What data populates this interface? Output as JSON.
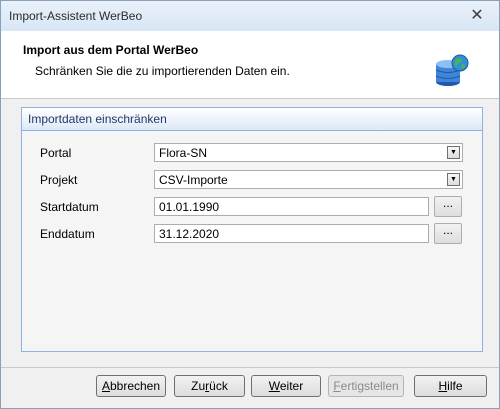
{
  "window": {
    "title": "Import-Assistent WerBeo",
    "close_label": "✕"
  },
  "header": {
    "title": "Import aus dem Portal WerBeo",
    "subtitle": "Schränken Sie die zu importierenden Daten ein.",
    "icon": "database-globe-icon"
  },
  "group": {
    "title": "Importdaten einschränken",
    "fields": {
      "portal": {
        "label": "Portal",
        "value": "Flora-SN"
      },
      "projekt": {
        "label": "Projekt",
        "value": "CSV-Importe"
      },
      "startdatum": {
        "label": "Startdatum",
        "value": "01.01.1990",
        "button": "..."
      },
      "enddatum": {
        "label": "Enddatum",
        "value": "31.12.2020",
        "button": "..."
      }
    }
  },
  "buttons": {
    "abbrechen": {
      "pre": "",
      "key": "A",
      "post": "bbrechen"
    },
    "zurueck": {
      "pre": "Zu",
      "key": "r",
      "post": "ück"
    },
    "weiter": {
      "pre": "",
      "key": "W",
      "post": "eiter"
    },
    "fertigstellen": {
      "pre": "",
      "key": "F",
      "post": "ertigstellen"
    },
    "hilfe": {
      "pre": "",
      "key": "H",
      "post": "ilfe"
    }
  }
}
